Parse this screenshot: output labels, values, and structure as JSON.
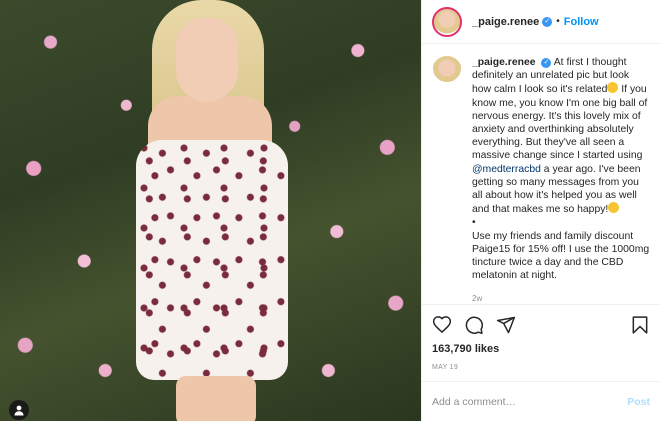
{
  "post": {
    "username": "_paige.renee",
    "follow_label": "Follow",
    "header_separator": "•",
    "caption": {
      "username": "_paige.renee",
      "text_part1": "At first I thought definitely an unrelated pic but look how calm I look so it's related",
      "text_part2": " If you know me, you know I'm one big ball of nervous energy. It's this lovely mix of anxiety and overthinking absolutely everything. But they've all seen a massive change since I started using ",
      "mention": "@medterracbd",
      "text_part3": " a year ago. I've been getting so many messages from you all about how it's helped you as well and that makes me so happy!",
      "text_part4": "\n•\nUse my friends and family discount Paige15 for 15% off! I use the 1000mg tincture twice a day and the CBD melatonin at night.",
      "age": "2w"
    },
    "likes": "163,790 likes",
    "date": "MAY 19",
    "comment_placeholder": "Add a comment…",
    "post_label": "Post"
  },
  "icons": {
    "heart": "heart-icon",
    "comment": "comment-icon",
    "share": "share-icon",
    "save": "bookmark-icon",
    "user_tag": "user-tag-icon",
    "verified": "verified-badge-icon",
    "more": "more-options-icon"
  },
  "colors": {
    "accent": "#0095f6",
    "verified": "#3897f0",
    "muted": "#8e8e8e",
    "post_disabled": "#b2dffc"
  }
}
